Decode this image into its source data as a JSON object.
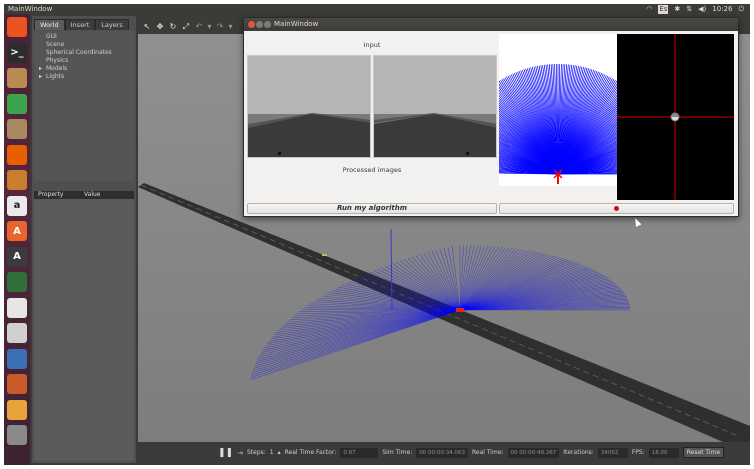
{
  "topbar": {
    "title": "MainWindow",
    "keyboard": "Es",
    "time": "10:26"
  },
  "launcher": {
    "items": [
      {
        "name": "dash-icon",
        "glyph": "",
        "color": "#e95420"
      },
      {
        "name": "terminal-icon",
        "glyph": ">_",
        "color": "#2c2c2c"
      },
      {
        "name": "files-icon",
        "glyph": "",
        "color": "#b98b52"
      },
      {
        "name": "spreadsheet-icon",
        "glyph": "",
        "color": "#3aa54c"
      },
      {
        "name": "archive-icon",
        "glyph": "",
        "color": "#a88a60"
      },
      {
        "name": "firefox-icon",
        "glyph": "",
        "color": "#e66000"
      },
      {
        "name": "document-viewer-icon",
        "glyph": "",
        "color": "#c87f2d"
      },
      {
        "name": "amazon-icon",
        "glyph": "a",
        "color": "#eaeaea"
      },
      {
        "name": "software-center-icon",
        "glyph": "A",
        "color": "#e9652c"
      },
      {
        "name": "updater-icon",
        "glyph": "A",
        "color": "#3b3b3b"
      },
      {
        "name": "globe-icon",
        "glyph": "",
        "color": "#2f6f3a"
      },
      {
        "name": "text-editor-icon",
        "glyph": "",
        "color": "#e6e6e6"
      },
      {
        "name": "drive-icon",
        "glyph": "",
        "color": "#d0d0d0"
      },
      {
        "name": "writer-icon",
        "glyph": "",
        "color": "#3d6fb5"
      },
      {
        "name": "media-icon",
        "glyph": "",
        "color": "#c95b2b"
      },
      {
        "name": "gazebo-icon",
        "glyph": "",
        "color": "#e8a33a"
      },
      {
        "name": "trash-icon",
        "glyph": "",
        "color": "#8a8a8a"
      }
    ]
  },
  "gazebo": {
    "tabs": [
      "World",
      "Insert",
      "Layers"
    ],
    "tree": [
      "GUI",
      "Scene",
      "Spherical Coordinates",
      "Physics",
      "Models",
      "Lights"
    ],
    "props_header": [
      "Property",
      "Value"
    ],
    "bottom": {
      "steps_label": "Steps:",
      "steps_value": "1",
      "rtf_label": "Real Time Factor:",
      "rtf_value": "0.87",
      "sim_label": "Sim Time:",
      "sim_value": "00 00:00:34.063",
      "real_label": "Real Time:",
      "real_value": "00 00:00:49.267",
      "iter_label": "Iterations:",
      "iter_value": "34062",
      "fps_label": "FPS:",
      "fps_value": "18.00",
      "reset_label": "Reset Time"
    }
  },
  "mainwindow": {
    "title": "MainWindow",
    "input_caption": "Input",
    "processed_caption": "Processed images",
    "run_button": "Run my algorithm",
    "laser_color": "#0000ff",
    "crosshair_color": "#ff0000"
  }
}
